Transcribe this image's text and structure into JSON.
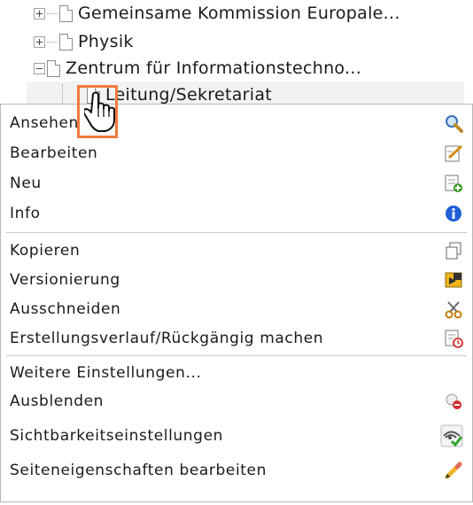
{
  "tree": {
    "items": [
      {
        "label": "Gemeinsame Kommission Europale...",
        "expander": "plus"
      },
      {
        "label": "Physik",
        "expander": "plus"
      },
      {
        "label": "Zentrum für Informationstechno...",
        "expander": "minus"
      },
      {
        "label": "Leitung/Sekretariat"
      }
    ]
  },
  "context_menu": {
    "groups": [
      [
        {
          "label": "Ansehen",
          "icon": "magnifier-icon"
        },
        {
          "label": "Bearbeiten",
          "icon": "edit-page-icon"
        },
        {
          "label": "Neu",
          "icon": "new-page-icon"
        },
        {
          "label": "Info",
          "icon": "info-icon"
        }
      ],
      [
        {
          "label": "Kopieren",
          "icon": "copy-icon"
        },
        {
          "label": "Versionierung",
          "icon": "versioning-icon"
        },
        {
          "label": "Ausschneiden",
          "icon": "scissors-icon"
        },
        {
          "label": "Erstellungsverlauf/Rückgängig machen",
          "icon": "history-icon"
        }
      ],
      [
        {
          "label": "Weitere Einstellungen...",
          "icon": ""
        },
        {
          "label": "Ausblenden",
          "icon": "hide-icon"
        },
        {
          "label": "Sichtbarkeitseinstellungen",
          "icon": "visibility-icon"
        },
        {
          "label": "Seiteneigenschaften bearbeiten",
          "icon": "pencil-icon"
        }
      ]
    ]
  },
  "colors": {
    "highlight": "#f07a3c",
    "info": "#1e5fd6",
    "add": "#3a9a2a",
    "stop": "#d62a2a"
  }
}
